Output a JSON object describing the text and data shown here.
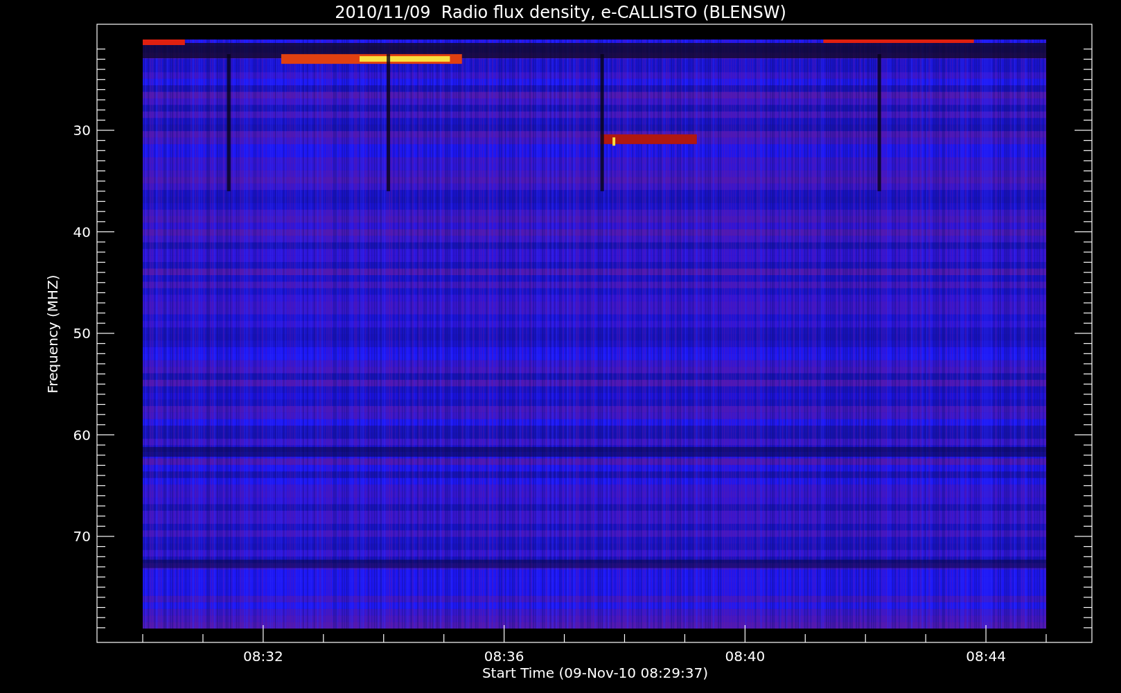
{
  "plot": {
    "title": "2010/11/09  Radio flux density, e-CALLISTO (BLENSW)",
    "ylabel": "Frequency (MHZ)",
    "xlabel": "Start Time (09-Nov-10 08:29:37)",
    "yticks": [
      "30",
      "40",
      "50",
      "60",
      "70"
    ],
    "xticks": [
      "08:32",
      "08:36",
      "08:40",
      "08:44"
    ]
  }
}
